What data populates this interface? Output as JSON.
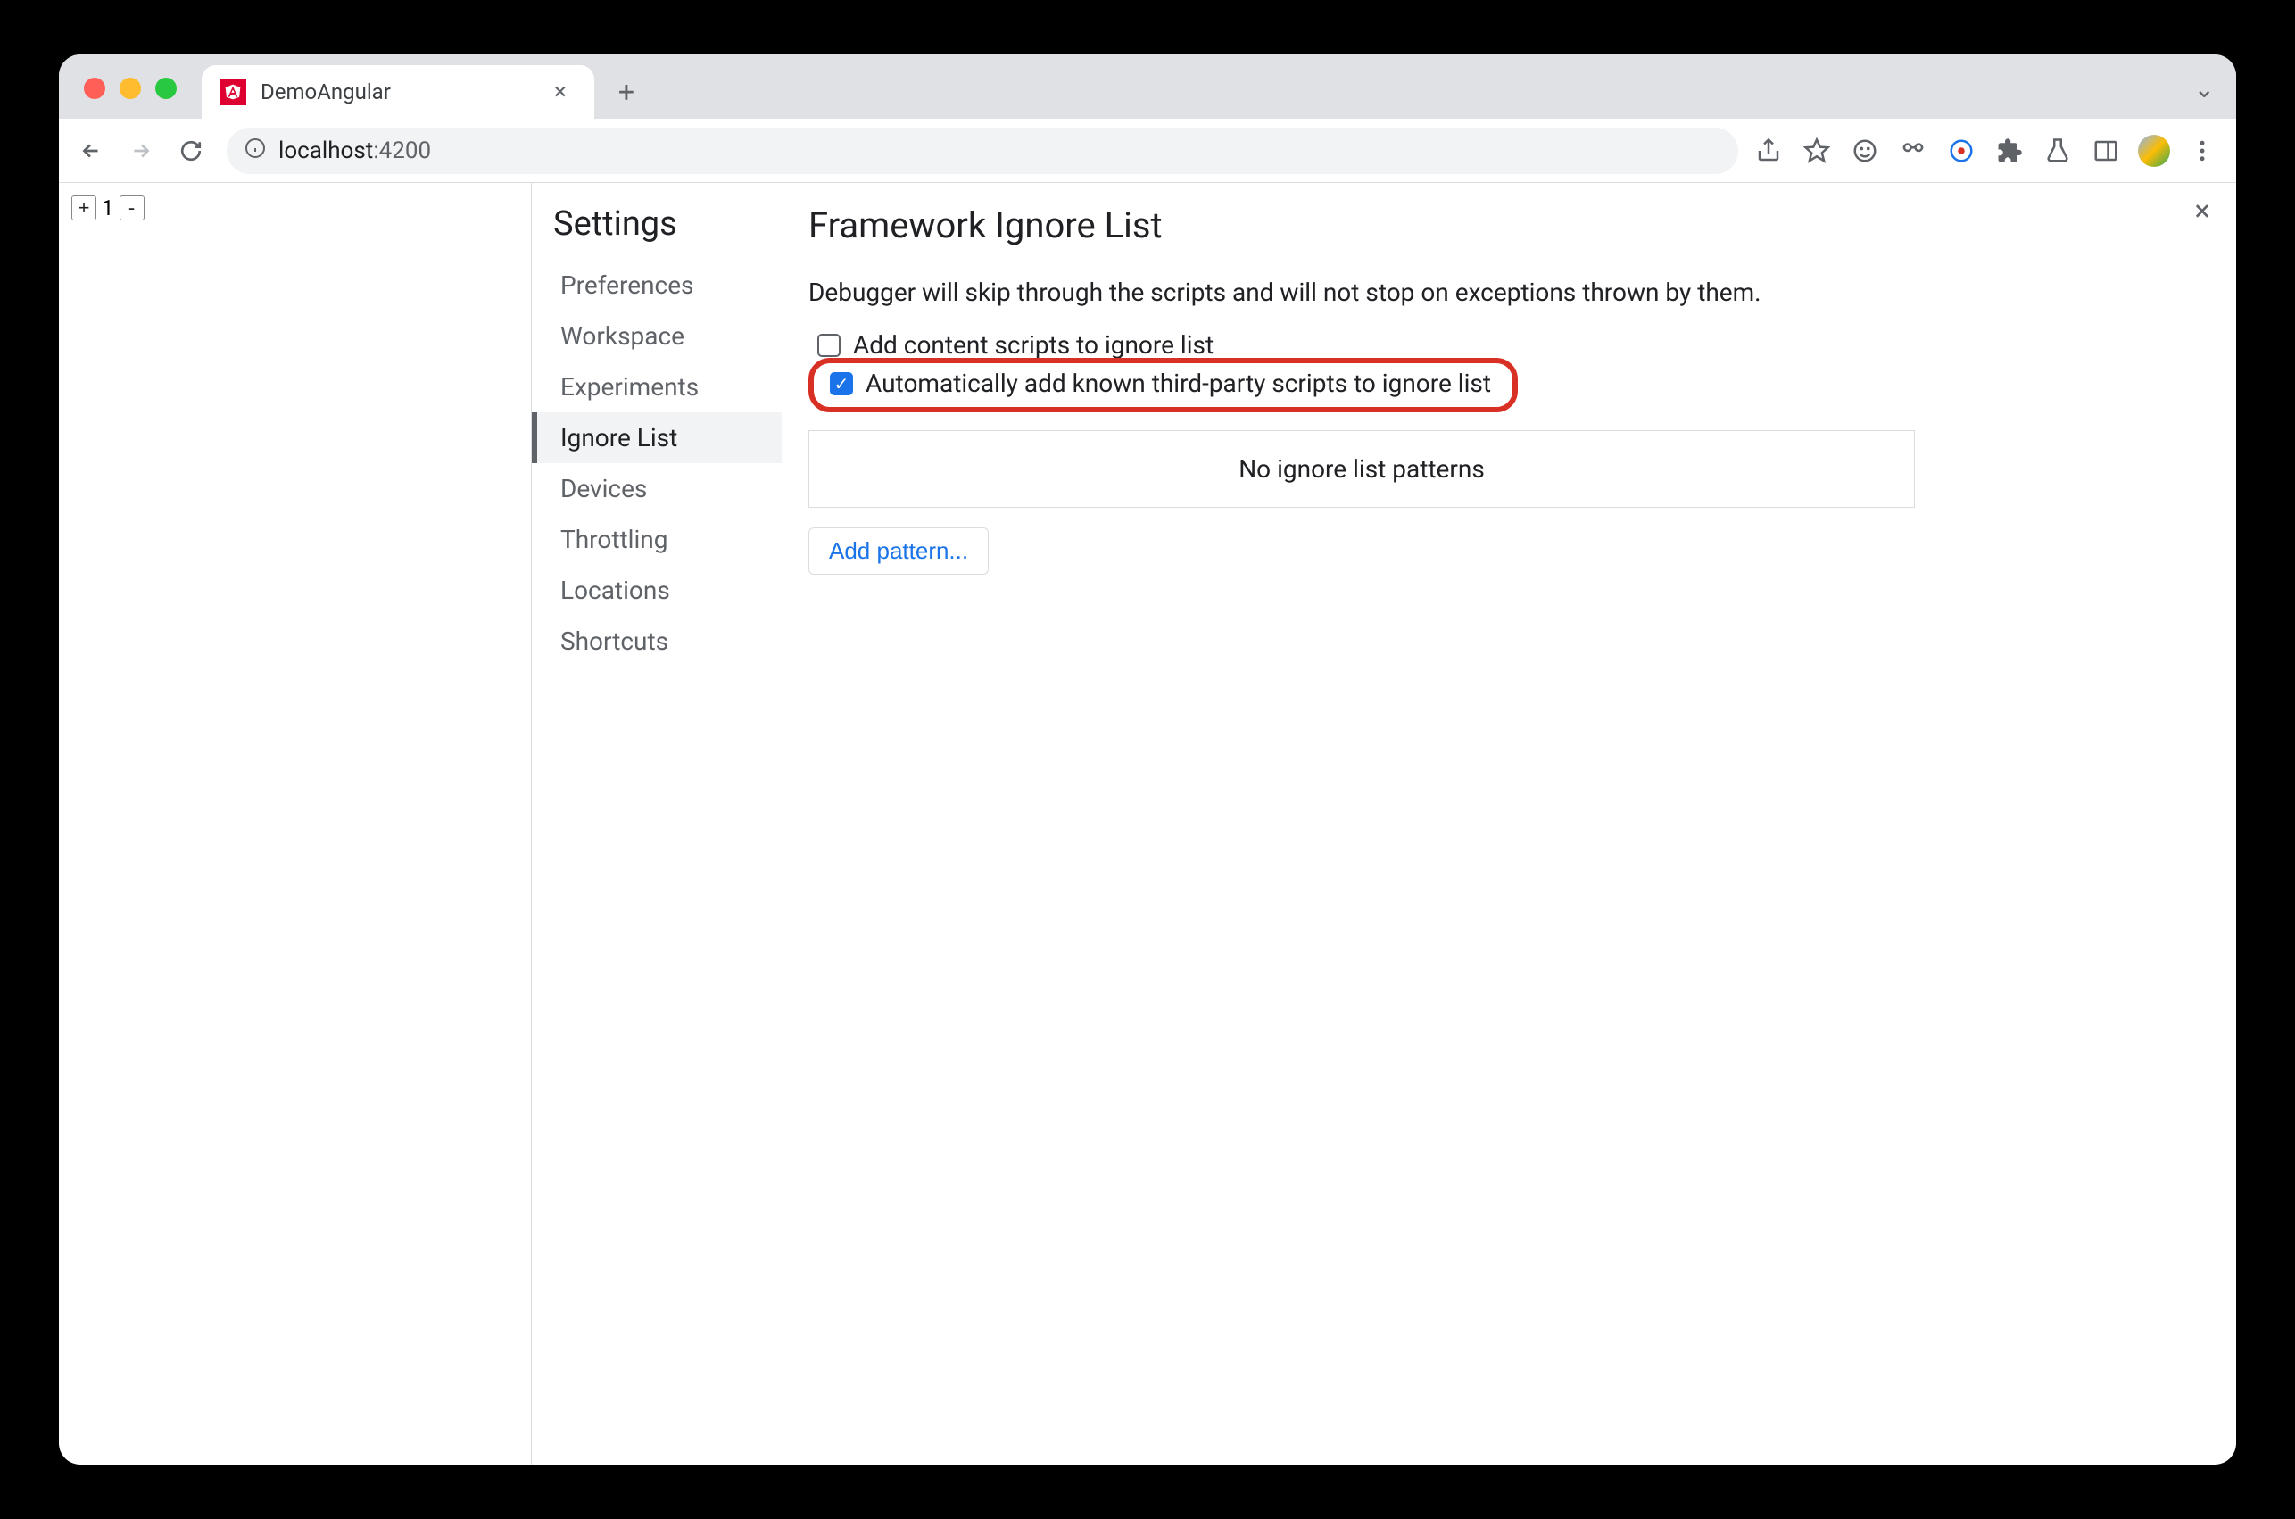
{
  "tab": {
    "title": "DemoAngular"
  },
  "url": {
    "host": "localhost",
    "port": ":4200"
  },
  "page": {
    "plus": "+",
    "counter": "1",
    "minus": "-"
  },
  "settings": {
    "title": "Settings",
    "menu": [
      "Preferences",
      "Workspace",
      "Experiments",
      "Ignore List",
      "Devices",
      "Throttling",
      "Locations",
      "Shortcuts"
    ],
    "activeIndex": 3
  },
  "main": {
    "heading": "Framework Ignore List",
    "description": "Debugger will skip through the scripts and will not stop on exceptions thrown by them.",
    "chk1": {
      "label": "Add content scripts to ignore list",
      "checked": false
    },
    "chk2": {
      "label": "Automatically add known third-party scripts to ignore list",
      "checked": true
    },
    "emptyPatterns": "No ignore list patterns",
    "addPattern": "Add pattern..."
  }
}
